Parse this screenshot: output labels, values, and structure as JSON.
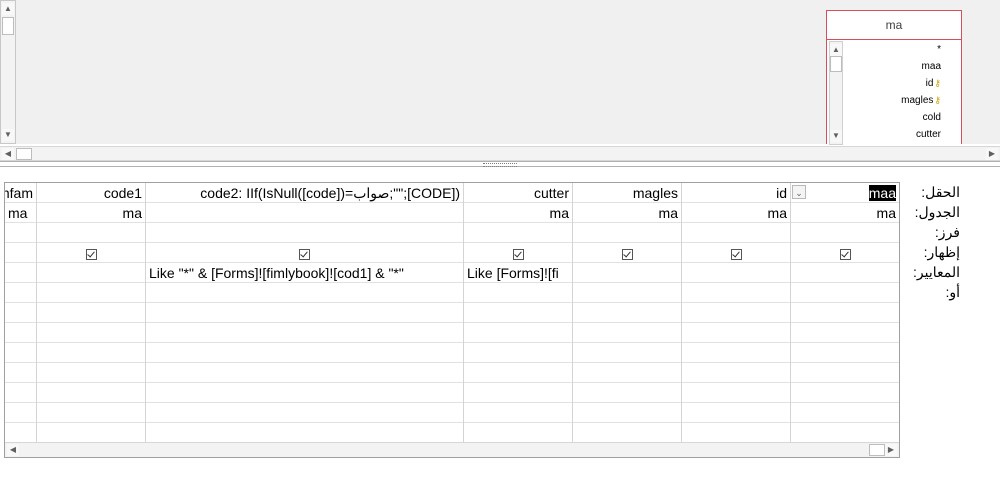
{
  "table_box": {
    "title": "ma",
    "fields": [
      {
        "name": "*",
        "key": false
      },
      {
        "name": "maa",
        "key": false
      },
      {
        "name": "id",
        "key": true
      },
      {
        "name": "magles",
        "key": true
      },
      {
        "name": "cold",
        "key": false
      },
      {
        "name": "cutter",
        "key": false
      }
    ]
  },
  "row_labels": [
    "الحقل:",
    "الجدول:",
    "فرز:",
    "إظهار:",
    "المعايير:",
    "أو:"
  ],
  "grid": {
    "columns": [
      {
        "field": "maa",
        "table": "ma",
        "sort": "",
        "show": true,
        "criteria": "",
        "or": "",
        "selected": true
      },
      {
        "field": "id",
        "table": "ma",
        "sort": "",
        "show": true,
        "criteria": "",
        "or": ""
      },
      {
        "field": "magles",
        "table": "ma",
        "sort": "",
        "show": true,
        "criteria": "",
        "or": ""
      },
      {
        "field": "cutter",
        "table": "ma",
        "sort": "",
        "show": true,
        "criteria": "Like [Forms]![fi",
        "or": ""
      },
      {
        "field": "code2: IIf(IsNull([code])=صواب;\"\";[CODE])",
        "table": "",
        "sort": "",
        "show": true,
        "criteria": "Like \"*\" & [Forms]![fimlybook]![cod1] & \"*\"",
        "or": ""
      },
      {
        "field": "code1",
        "table": "ma",
        "sort": "",
        "show": true,
        "criteria": "",
        "or": ""
      },
      {
        "field": "nfam",
        "table": "ma",
        "sort": "",
        "show": false,
        "criteria": "",
        "or": ""
      }
    ]
  },
  "icons": {
    "scroll_up": "triangle-up-icon",
    "scroll_down": "triangle-down-icon",
    "scroll_left": "triangle-left-icon",
    "scroll_right": "triangle-right-icon",
    "key": "key-icon",
    "checkbox": "checkbox-checked-icon",
    "dropdown": "chevron-down-icon"
  },
  "colors": {
    "table_border": "#d3505a",
    "pane_bg": "#f0f0f0",
    "selection_bg": "#000000"
  }
}
